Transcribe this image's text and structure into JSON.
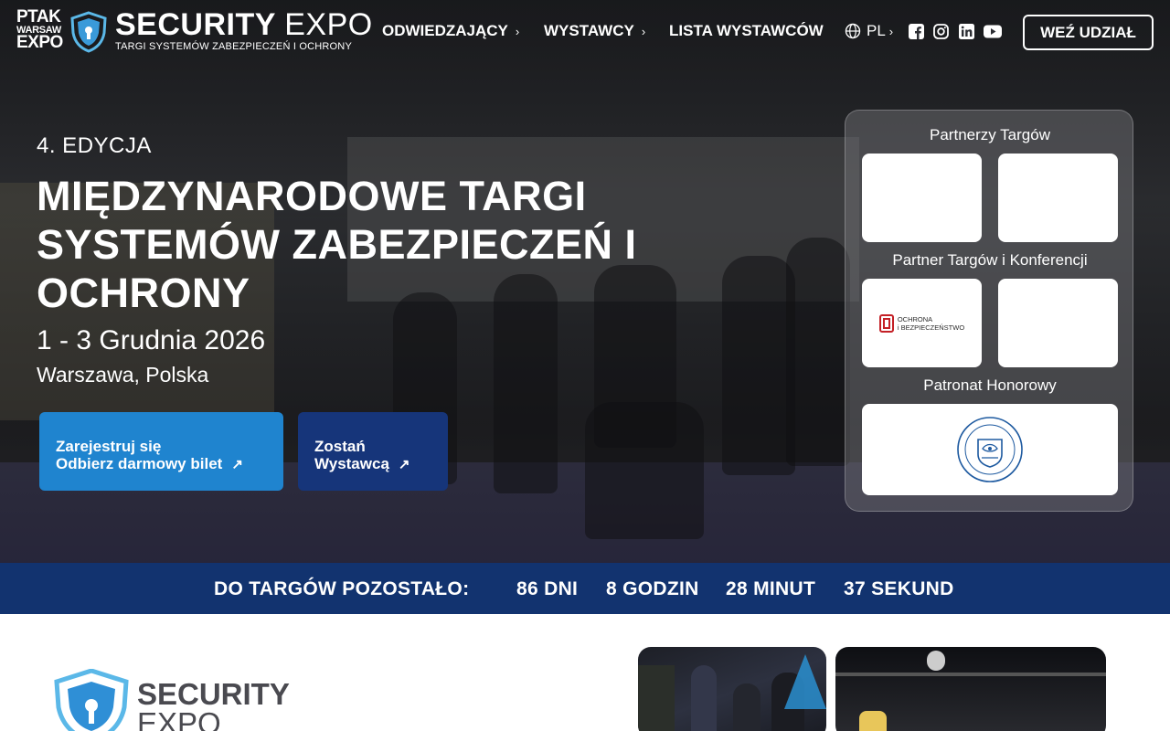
{
  "header": {
    "ptak_logo": {
      "line1": "PTAK",
      "line2": "WARSAW",
      "line3": "EXPO"
    },
    "brand": {
      "name_bold": "SECURITY",
      "name_thin": "EXPO",
      "tagline": "TARGI SYSTEMÓW ZABEZPIECZEŃ I OCHRONY"
    },
    "nav": [
      {
        "label": "ODWIEDZAJĄCY",
        "has_submenu": true
      },
      {
        "label": "WYSTAWCY",
        "has_submenu": true
      },
      {
        "label": "LISTA WYSTAWCÓW",
        "has_submenu": false
      }
    ],
    "language": {
      "label": "PL",
      "icon": "globe-icon"
    },
    "social": [
      "facebook-icon",
      "instagram-icon",
      "linkedin-icon",
      "youtube-icon"
    ],
    "cta_label": "WEŹ UDZIAŁ"
  },
  "hero": {
    "edition": "4. EDYCJA",
    "title": "MIĘDZYNARODOWE TARGI SYSTEMÓW ZABEZPIECZEŃ I OCHRONY",
    "dates": "1 - 3 Grudnia 2026",
    "place": "Warszawa, Polska",
    "register_button": {
      "line1": "Zarejestruj się",
      "line2": "Odbierz darmowy bilet"
    },
    "exhibitor_button": {
      "line1": "Zostań",
      "line2": "Wystawcą"
    }
  },
  "partners": {
    "section1": "Partnerzy Targów",
    "section2": "Partner Targów i Konferencji",
    "section3": "Patronat Honorowy",
    "ochrona_logo": {
      "line1": "OCHRONA",
      "line2": "i BEZPIECZEŃSTWO"
    }
  },
  "countdown": {
    "label": "DO TARGÓW POZOSTAŁO:",
    "days": "86",
    "days_unit": "DNI",
    "hours": "8",
    "hours_unit": "GODZIN",
    "minutes": "28",
    "minutes_unit": "MINUT",
    "seconds": "37",
    "seconds_unit": "SEKUND"
  },
  "below": {
    "logo_line1": "SECURITY",
    "logo_line2": "EXPO"
  },
  "colors": {
    "primary_blue": "#1f84cf",
    "dark_blue": "#16357a",
    "countdown_bg": "#12336f"
  }
}
